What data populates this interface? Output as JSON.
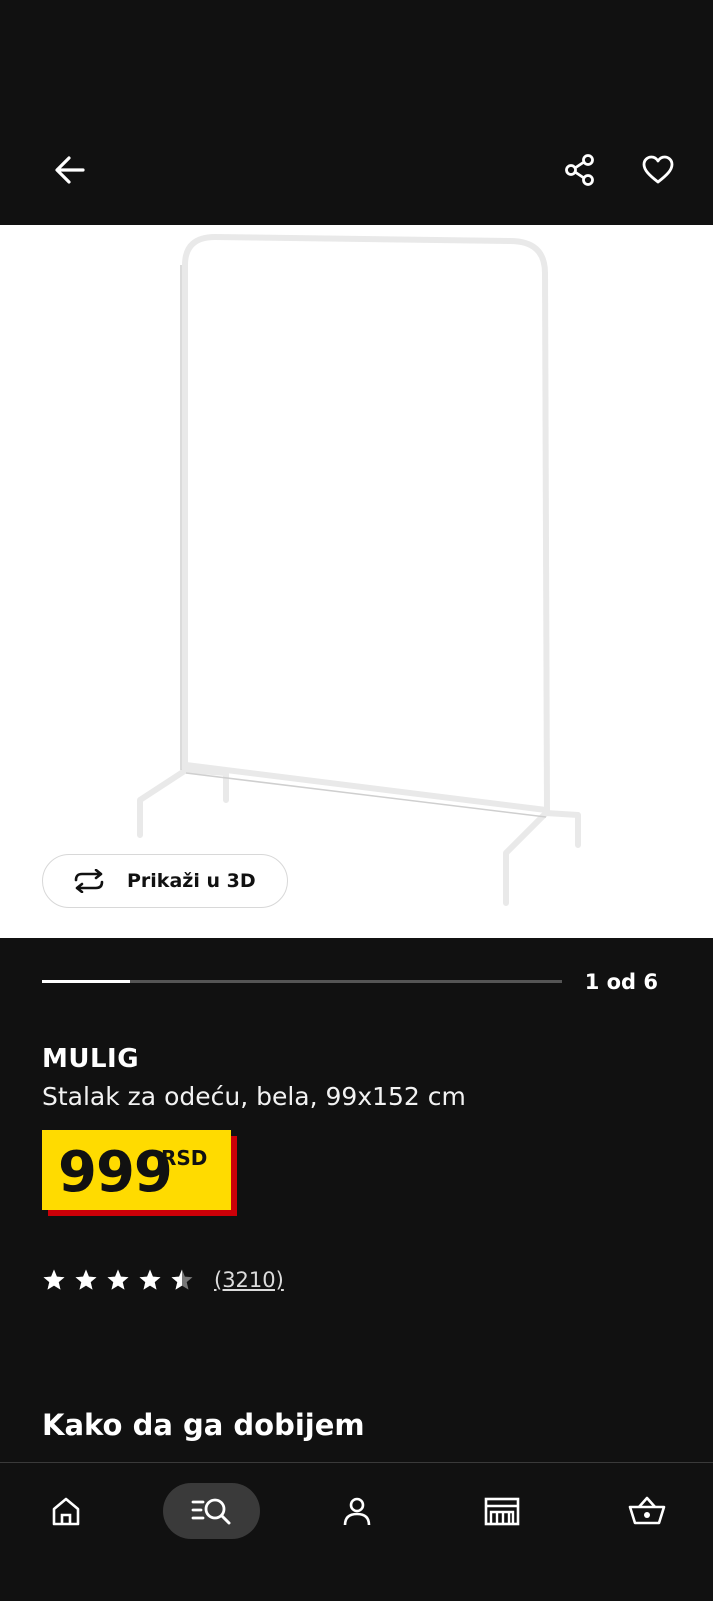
{
  "header": {
    "back_icon": "arrow-left-icon",
    "share_icon": "share-icon",
    "favorite_icon": "heart-outline-icon"
  },
  "gallery": {
    "image": "white clothes rack",
    "view_3d_label": "Prikaži u 3D",
    "view_3d_icon": "rotate-3d-icon",
    "counter": "1 od 6",
    "progress": 0.17
  },
  "product": {
    "name": "MULIG",
    "description": "Stalak za odeću, bela, 99x152 cm",
    "price": "999",
    "currency": "RSD",
    "rating": 4.5,
    "review_count": "(3210)"
  },
  "section": {
    "title": "Kako da ga dobijem"
  },
  "bottom_nav": [
    {
      "icon": "home-icon",
      "active": false
    },
    {
      "icon": "search-list-icon",
      "active": true
    },
    {
      "icon": "profile-icon",
      "active": false
    },
    {
      "icon": "store-icon",
      "active": false
    },
    {
      "icon": "cart-icon",
      "active": false
    }
  ],
  "colors": {
    "background": "#111111",
    "price_bg": "#ffdb00",
    "price_shadow": "#cc0008",
    "active_nav_bg": "#3a3a3a"
  }
}
